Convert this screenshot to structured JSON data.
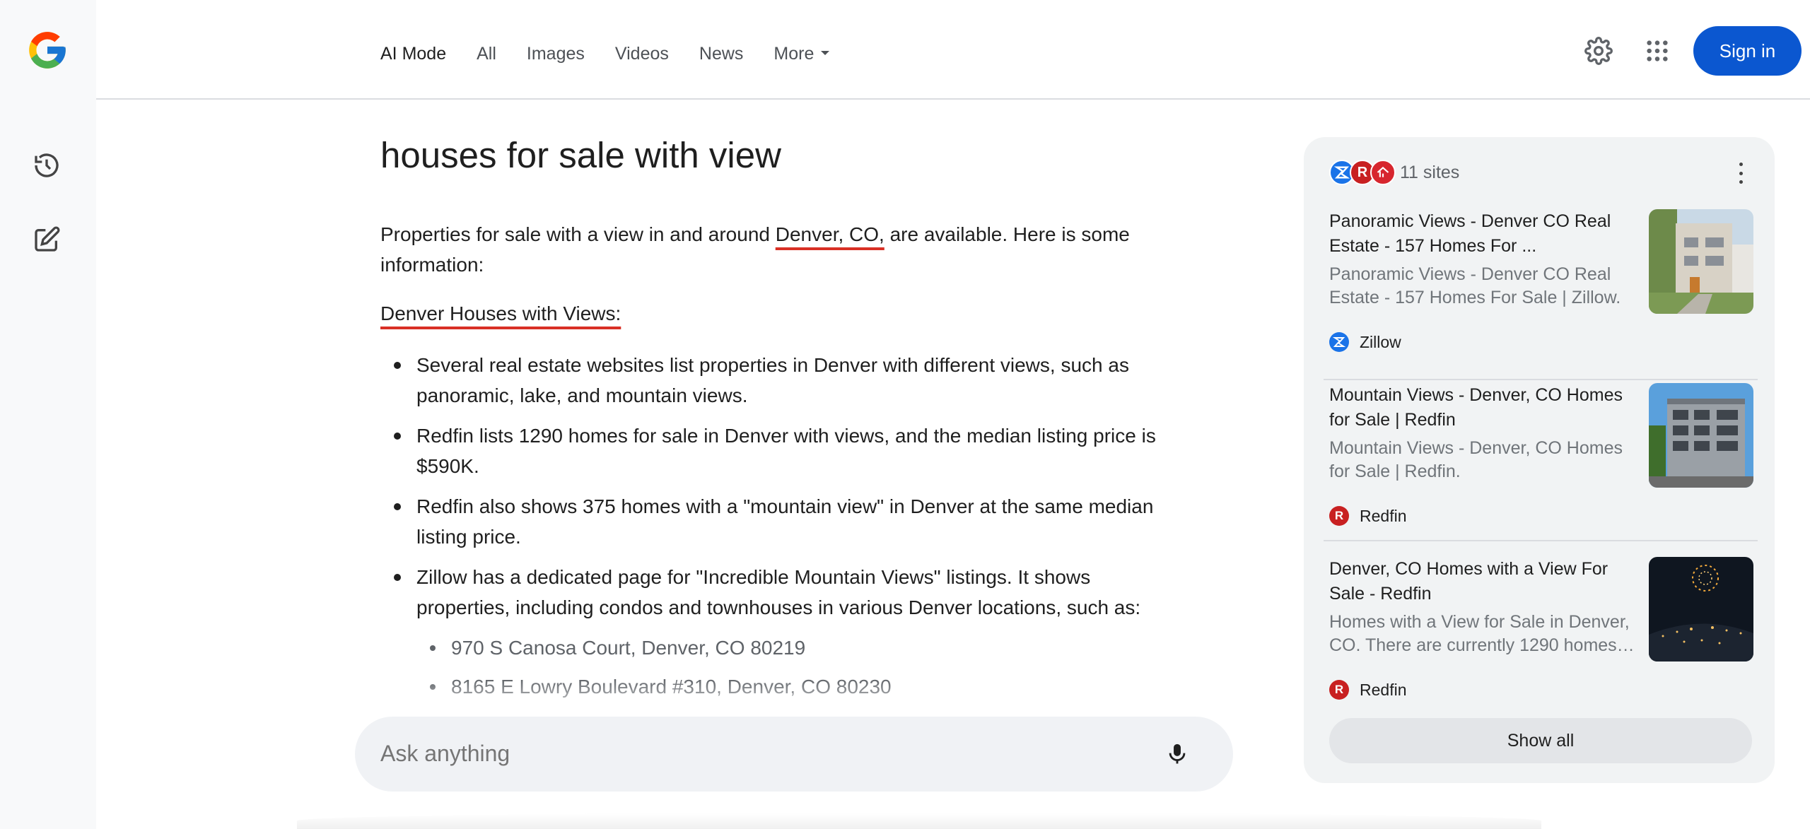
{
  "header": {
    "tabs": [
      {
        "label": "AI Mode"
      },
      {
        "label": "All"
      },
      {
        "label": "Images"
      },
      {
        "label": "Videos"
      },
      {
        "label": "News"
      },
      {
        "label": "More"
      }
    ],
    "signin_label": "Sign in",
    "icons": [
      "settings-icon",
      "apps-grid-icon"
    ]
  },
  "rail": {
    "icons": [
      "google-logo",
      "history-icon",
      "new-chat-icon"
    ]
  },
  "main": {
    "query": "houses for sale with view",
    "intro_before": "Properties for sale with a view in and around ",
    "intro_highlight": "Denver, CO,",
    "intro_after": " are available. Here is some information:",
    "subhead": "Denver Houses with Views:",
    "bullets": [
      "Several real estate websites list properties in Denver with different views, such as panoramic, lake, and mountain views.",
      "Redfin lists 1290 homes for sale in Denver with views, and the median listing price is $590K.",
      "Redfin also shows 375 homes with a \"mountain view\" in Denver at the same median listing price.",
      "Zillow has a dedicated page for \"Incredible Mountain Views\" listings. It shows properties, including condos and townhouses in various Denver locations, such as:"
    ],
    "subbullets": [
      "970 S Canosa Court, Denver, CO 80219",
      "8165 E Lowry Boulevard #310, Denver, CO 80230"
    ]
  },
  "ask": {
    "placeholder": "Ask anything"
  },
  "sources": {
    "count_label": "11 sites",
    "cards": [
      {
        "title": "Panoramic Views - Denver CO Real Estate - 157 Homes For ...",
        "snippet": "Panoramic Views - Denver CO Real Estate - 157 Homes For Sale | Zillow.",
        "source": "Zillow"
      },
      {
        "title": "Mountain Views - Denver, CO Homes for Sale | Redfin",
        "snippet": "Mountain Views - Denver, CO Homes for Sale | Redfin.",
        "source": "Redfin"
      },
      {
        "title": "Denver, CO Homes with a View For Sale - Redfin",
        "snippet": "Homes with a View for Sale in Denver, CO. There are currently 1290 homes…",
        "source": "Redfin"
      }
    ],
    "show_all_label": "Show all"
  },
  "colors": {
    "accent": "#0b57d0",
    "underline": "#d93025",
    "zillow": "#1a73e8",
    "redfin": "#c82021"
  }
}
